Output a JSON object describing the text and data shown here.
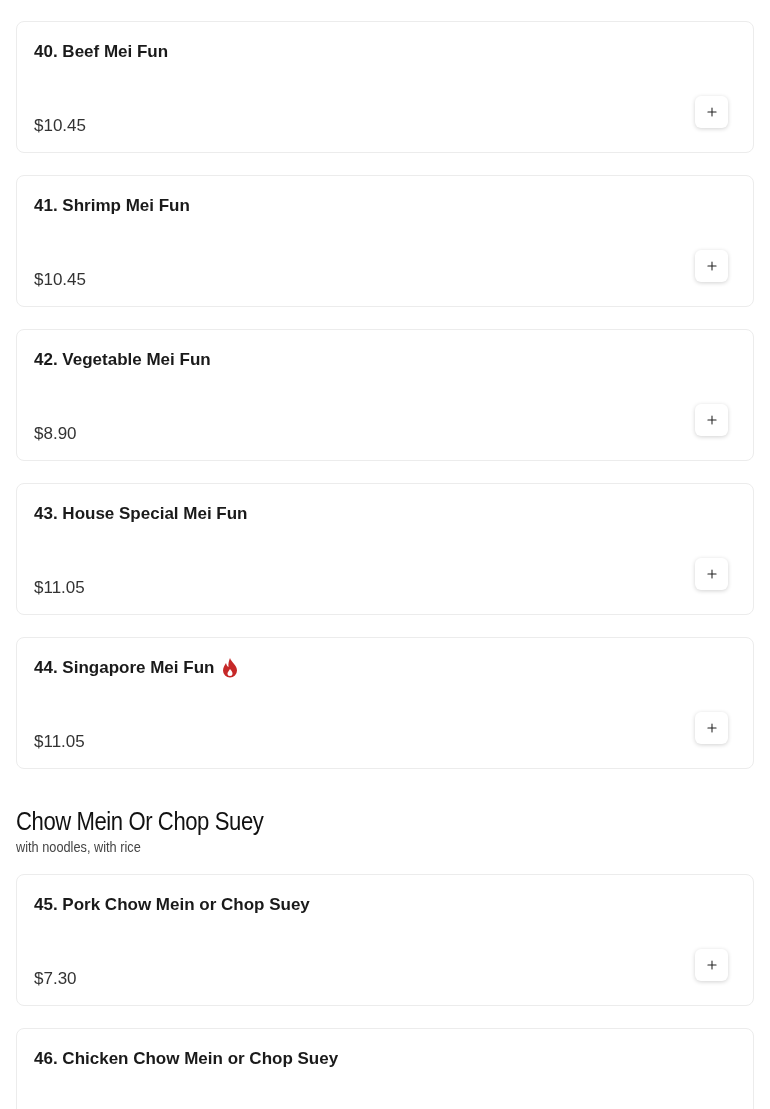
{
  "sections": [
    {
      "items": [
        {
          "name": "40. Beef Mei Fun",
          "price": "$10.45",
          "spicy": false
        },
        {
          "name": "41. Shrimp Mei Fun",
          "price": "$10.45",
          "spicy": false
        },
        {
          "name": "42. Vegetable Mei Fun",
          "price": "$8.90",
          "spicy": false
        },
        {
          "name": "43. House Special Mei Fun",
          "price": "$11.05",
          "spicy": false
        },
        {
          "name": "44. Singapore Mei Fun",
          "price": "$11.05",
          "spicy": true
        }
      ]
    },
    {
      "title": "Chow Mein Or Chop Suey",
      "subtitle": "with noodles, with rice",
      "items": [
        {
          "name": "45. Pork Chow Mein or Chop Suey",
          "price": "$7.30",
          "spicy": false
        },
        {
          "name": "46. Chicken Chow Mein or Chop Suey",
          "spicy": false
        }
      ]
    }
  ]
}
